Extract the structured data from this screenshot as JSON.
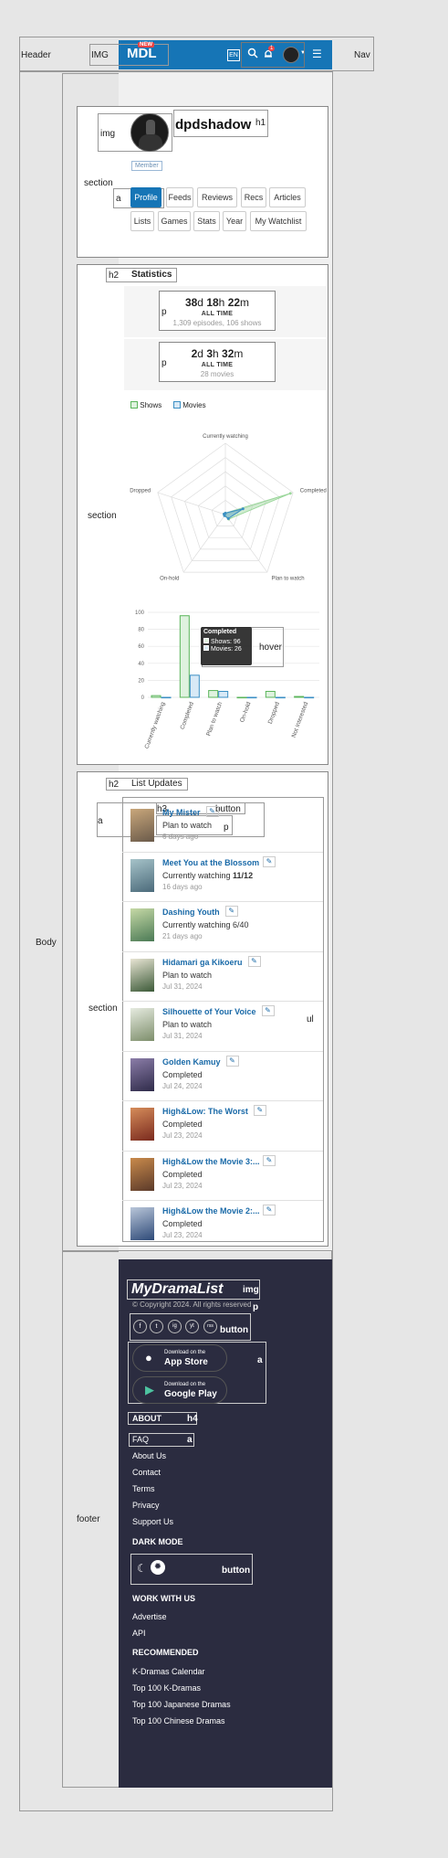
{
  "annotations": {
    "header": "Header",
    "img_logo": "IMG",
    "nav": "Nav",
    "body": "Body",
    "img_avatar": "img",
    "h1": "h1",
    "section": "section",
    "a": "a",
    "h2": "h2",
    "p": "p",
    "main": "main",
    "hover": "hover",
    "h3": "h3",
    "button": "button",
    "ul": "ul",
    "footer": "footer",
    "h4": "h4"
  },
  "header": {
    "logo": "MDL",
    "logo_badge": "NEW",
    "lang": "EN",
    "notif_count": "1"
  },
  "profile": {
    "username": "dpdshadow",
    "role": "Member",
    "tabs": [
      "Profile",
      "Feeds",
      "Reviews",
      "Recs",
      "Articles",
      "Lists",
      "Games",
      "Stats",
      "Year",
      "My Watchlist"
    ],
    "active_tab": "Profile"
  },
  "statistics": {
    "heading": "Statistics",
    "shows_time": {
      "d": "38",
      "h": "18",
      "m": "22",
      "label": "ALL TIME",
      "sub": "1,309 episodes, 106 shows"
    },
    "movies_time": {
      "d": "2",
      "h": "3",
      "m": "32",
      "label": "ALL TIME",
      "sub": "28 movies"
    },
    "legend": [
      "Shows",
      "Movies"
    ],
    "colors": {
      "shows": "#9bd79b",
      "movies": "#3b8fc4"
    }
  },
  "chart_data": [
    {
      "type": "radar",
      "axes": [
        "Currently watching",
        "Completed",
        "Plan to watch",
        "On-hold",
        "Dropped"
      ],
      "series": [
        {
          "name": "Shows",
          "values": [
            2,
            96,
            8,
            0,
            1
          ]
        },
        {
          "name": "Movies",
          "values": [
            0,
            26,
            7,
            0,
            0
          ]
        }
      ]
    },
    {
      "type": "bar",
      "categories": [
        "Currently watching",
        "Completed",
        "Plan to watch",
        "On-hold",
        "Dropped",
        "Not Interested"
      ],
      "series": [
        {
          "name": "Shows",
          "values": [
            2,
            96,
            8,
            0,
            7,
            1
          ]
        },
        {
          "name": "Movies",
          "values": [
            0,
            26,
            7,
            0,
            0,
            0
          ]
        }
      ],
      "yticks": [
        0,
        20,
        40,
        60,
        80,
        100
      ],
      "ylim": [
        0,
        100
      ],
      "tooltip": {
        "title": "Completed",
        "lines": [
          "Shows: 96",
          "Movies: 26"
        ]
      }
    }
  ],
  "updates": {
    "heading": "List Updates",
    "items": [
      {
        "title": "My Mister",
        "status": "Plan to watch",
        "date": "6 days ago",
        "colors": [
          "#6a5a4a",
          "#c9a77b"
        ]
      },
      {
        "title": "Meet You at the Blossom",
        "status": "Currently watching ",
        "status_bold": "11/12",
        "date": "16 days ago",
        "colors": [
          "#4b6a7a",
          "#a6c3c9"
        ]
      },
      {
        "title": "Dashing Youth",
        "status": "Currently watching 6/40",
        "date": "21 days ago",
        "colors": [
          "#4b7a55",
          "#c6d9a6"
        ]
      },
      {
        "title": "Hidamari ga Kikoeru",
        "status": "Plan to watch",
        "date": "Jul 31, 2024",
        "colors": [
          "#3c5a38",
          "#e8e5d4"
        ]
      },
      {
        "title": "Silhouette of Your Voice",
        "status": "Plan to watch",
        "date": "Jul 31, 2024",
        "colors": [
          "#7d8e6b",
          "#e6ebe0"
        ]
      },
      {
        "title": "Golden Kamuy",
        "status": "Completed",
        "date": "Jul 24, 2024",
        "colors": [
          "#2f2b4a",
          "#8b7da8"
        ]
      },
      {
        "title": "High&Low: The Worst",
        "status": "Completed",
        "date": "Jul 23, 2024",
        "colors": [
          "#7a2a1e",
          "#d58c5a"
        ]
      },
      {
        "title": "High&Low the Movie 3:...",
        "status": "Completed",
        "date": "Jul 23, 2024",
        "colors": [
          "#5b3a2a",
          "#c98a4b"
        ]
      },
      {
        "title": "High&Low the Movie 2:...",
        "status": "Completed",
        "date": "Jul 23, 2024",
        "colors": [
          "#2e4a78",
          "#b9c6d9"
        ]
      }
    ]
  },
  "footer": {
    "brand": "MyDramaList",
    "copyright": "© Copyright 2024. All rights reserved",
    "social": [
      "f",
      "t",
      "ig",
      "yt",
      "rss"
    ],
    "appstore_small": "Download on the",
    "appstore_big": "App Store",
    "googleplay_small": "Download on the",
    "googleplay_big": "Google Play",
    "about_heading": "ABOUT",
    "about_links": [
      "FAQ",
      "About Us",
      "Contact",
      "Terms",
      "Privacy",
      "Support Us"
    ],
    "darkmode_heading": "DARK MODE",
    "work_heading": "WORK WITH US",
    "work_links": [
      "Advertise",
      "API"
    ],
    "recommended_heading": "RECOMMENDED",
    "recommended_links": [
      "K-Dramas Calendar",
      "Top 100 K-Dramas",
      "Top 100 Japanese Dramas",
      "Top 100 Chinese Dramas"
    ]
  }
}
